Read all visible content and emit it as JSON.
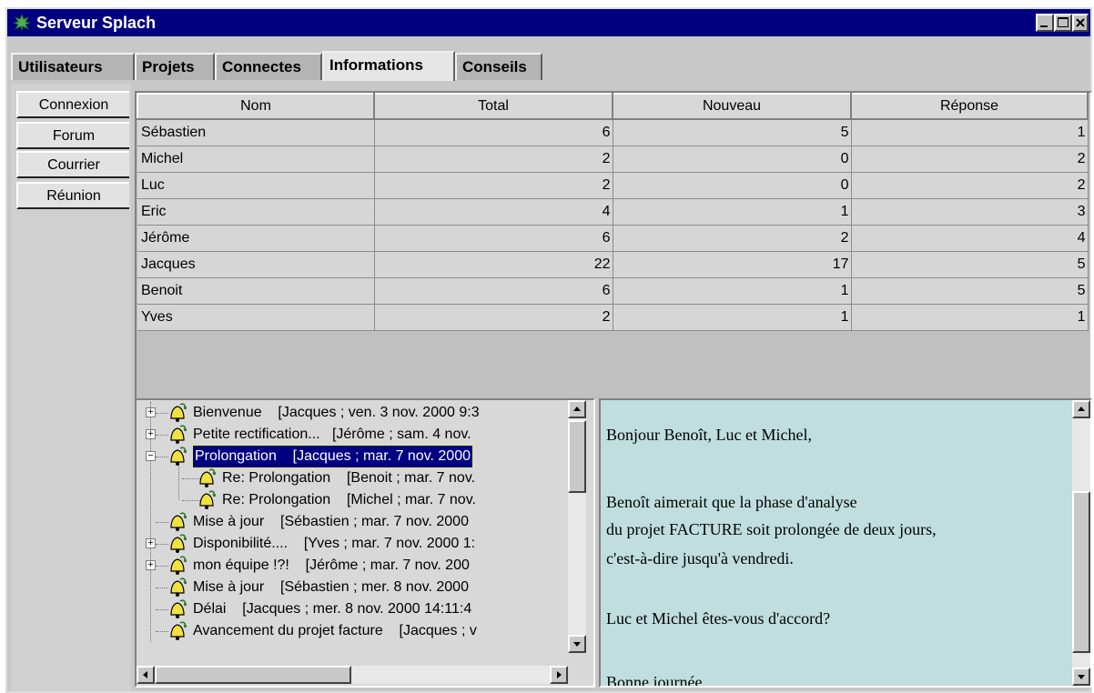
{
  "window": {
    "title": "Serveur Splach"
  },
  "top_tabs": [
    "Utilisateurs",
    "Projets",
    "Connectes",
    "Informations",
    "Conseils"
  ],
  "active_top_tab": "Informations",
  "side_tabs": [
    "Connexion",
    "Forum",
    "Courrier",
    "Réunion"
  ],
  "table": {
    "columns": [
      "Nom",
      "Total",
      "Nouveau",
      "Réponse"
    ],
    "rows": [
      {
        "nom": "Sébastien",
        "total": "6",
        "nouveau": "5",
        "reponse": "1"
      },
      {
        "nom": "Michel",
        "total": "2",
        "nouveau": "0",
        "reponse": "2"
      },
      {
        "nom": "Luc",
        "total": "2",
        "nouveau": "0",
        "reponse": "2"
      },
      {
        "nom": "Eric",
        "total": "4",
        "nouveau": "1",
        "reponse": "3"
      },
      {
        "nom": "Jérôme",
        "total": "6",
        "nouveau": "2",
        "reponse": "4"
      },
      {
        "nom": "Jacques",
        "total": "22",
        "nouveau": "17",
        "reponse": "5"
      },
      {
        "nom": "Benoit",
        "total": "6",
        "nouveau": "1",
        "reponse": "5"
      },
      {
        "nom": "Yves",
        "total": "2",
        "nouveau": "1",
        "reponse": "1"
      }
    ]
  },
  "tree": {
    "items": [
      {
        "label": "Bienvenue    [Jacques ; ven. 3 nov. 2000 9:3",
        "expander": "+",
        "level": 0
      },
      {
        "label": "Petite rectification...   [Jérôme ; sam. 4 nov.",
        "expander": "+",
        "level": 0
      },
      {
        "label": "Prolongation    [Jacques ; mar. 7 nov. 2000",
        "expander": "-",
        "level": 0,
        "selected": true
      },
      {
        "label": "Re: Prolongation    [Benoit ; mar. 7 nov.",
        "expander": "",
        "level": 1
      },
      {
        "label": "Re: Prolongation    [Michel ; mar. 7 nov.",
        "expander": "",
        "level": 1
      },
      {
        "label": "Mise à jour    [Sébastien ; mar. 7 nov. 2000",
        "expander": "",
        "level": 0
      },
      {
        "label": "Disponibilité....    [Yves ; mar. 7 nov. 2000 1:",
        "expander": "+",
        "level": 0
      },
      {
        "label": "mon équipe !?!    [Jérôme ; mar. 7 nov. 200",
        "expander": "+",
        "level": 0
      },
      {
        "label": "Mise à jour    [Sébastien ; mer. 8 nov. 2000",
        "expander": "",
        "level": 0
      },
      {
        "label": "Délai    [Jacques ; mer. 8 nov. 2000 14:11:4",
        "expander": "",
        "level": 0
      },
      {
        "label": "Avancement du projet facture    [Jacques ; v",
        "expander": "",
        "level": 0
      }
    ]
  },
  "message": {
    "lines": [
      "Bonjour Benoît, Luc et Michel,",
      "",
      "Benoît aimerait que la phase d'analyse",
      "du projet FACTURE soit prolongée de deux jours,",
      "c'est-à-dire jusqu'à vendredi.",
      "",
      "Luc et Michel êtes-vous d'accord?",
      "",
      "Bonne journée."
    ]
  },
  "colors": {
    "titlebar": "#000080",
    "selection": "#000080",
    "message_bg": "#c0dede",
    "bell": "#f0e040"
  },
  "icons": {
    "app": "tree-icon",
    "tree_item": "bell-icon"
  }
}
